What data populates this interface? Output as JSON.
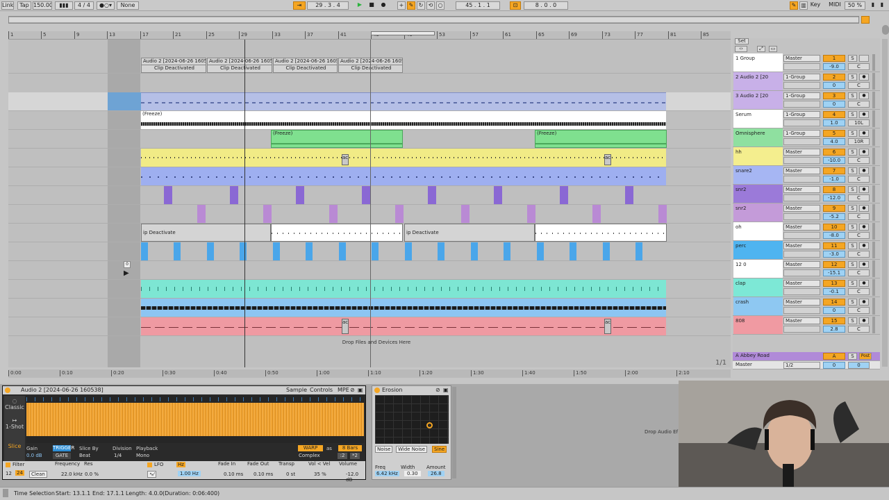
{
  "transport": {
    "link": "Link",
    "tap": "Tap",
    "tempo": "150.00",
    "time_sig": "4 / 4",
    "quantize": "None",
    "position": "29 .  3 .  4",
    "loop_start": "45 .  1 .  1",
    "loop_length": "8 .  0 .  0",
    "key": "Key",
    "midi": "MIDI",
    "cpu": "50 %"
  },
  "ruler": {
    "bars": [
      "1",
      "5",
      "9",
      "13",
      "17",
      "21",
      "25",
      "29",
      "33",
      "37",
      "41",
      "45",
      "49",
      "53",
      "57",
      "61",
      "65",
      "69",
      "73",
      "77",
      "81",
      "85"
    ]
  },
  "timeline": {
    "labels": [
      "0:00",
      "0:10",
      "0:20",
      "0:30",
      "0:40",
      "0:50",
      "1:00",
      "1:10",
      "1:20",
      "1:30",
      "1:40",
      "1:50",
      "2:00",
      "2:10"
    ],
    "page": "1/1"
  },
  "arrangement": {
    "clip_title": "Audio 2 [2024-06-26 1605",
    "clip_deactivated": "Clip Deactivated",
    "freeze": "(Freeze)",
    "short_deact": "ip Deactivate",
    "act": "act",
    "drop_hint": "Drop Files and Devices Here",
    "cursor_value": "0"
  },
  "mixer": {
    "set": "Set",
    "tracks": [
      {
        "name": "1 Group",
        "route": "Master",
        "num": "1",
        "vol": "-9.0",
        "pan": "C",
        "color": "#ffffff",
        "arm": ""
      },
      {
        "name": "2 Audio 2 [20",
        "route": "1-Group",
        "num": "2",
        "vol": "0",
        "pan": "C",
        "color": "#c8b0e8",
        "arm": "●"
      },
      {
        "name": "3 Audio 2 [20",
        "route": "1-Group",
        "num": "3",
        "vol": "0",
        "pan": "C",
        "color": "#c8b0e8",
        "arm": "●"
      },
      {
        "name": "Serum",
        "route": "1-Group",
        "num": "4",
        "vol": "1.0",
        "pan": "10L",
        "color": "#ffffff",
        "arm": "●"
      },
      {
        "name": "Omnisphere",
        "route": "1-Group",
        "num": "5",
        "vol": "4.0",
        "pan": "10R",
        "color": "#8fe0a0",
        "arm": "●"
      },
      {
        "name": "hh",
        "route": "Master",
        "num": "6",
        "vol": "-10.0",
        "pan": "C",
        "color": "#f4ee8e",
        "arm": "●"
      },
      {
        "name": "snare2",
        "route": "Master",
        "num": "7",
        "vol": "-1.0",
        "pan": "C",
        "color": "#a6b6f3",
        "arm": "●"
      },
      {
        "name": "snr2",
        "route": "Master",
        "num": "8",
        "vol": "-12.0",
        "pan": "C",
        "color": "#9b7ad9",
        "arm": "●"
      },
      {
        "name": "snr2",
        "route": "Master",
        "num": "9",
        "vol": "-5.2",
        "pan": "C",
        "color": "#c49bd9",
        "arm": "●"
      },
      {
        "name": "oh",
        "route": "Master",
        "num": "10",
        "vol": "-8.0",
        "pan": "C",
        "color": "#ffffff",
        "arm": "●"
      },
      {
        "name": "perc",
        "route": "Master",
        "num": "11",
        "vol": "-3.0",
        "pan": "C",
        "color": "#4fb4f0",
        "arm": "●"
      },
      {
        "name": "12 0",
        "route": "Master",
        "num": "12",
        "vol": "-15.1",
        "pan": "C",
        "color": "#ffffff",
        "arm": "●"
      },
      {
        "name": "clap",
        "route": "Master",
        "num": "13",
        "vol": "-0.1",
        "pan": "C",
        "color": "#7de8d6",
        "arm": "●"
      },
      {
        "name": "crash",
        "route": "Master",
        "num": "14",
        "vol": "0",
        "pan": "C",
        "color": "#8ec8f2",
        "arm": "●"
      },
      {
        "name": "808",
        "route": "Master",
        "num": "15",
        "vol": "2.8",
        "pan": "C",
        "color": "#f09aa2",
        "arm": "●"
      }
    ],
    "return": {
      "name": "A Abbey Road",
      "num": "A",
      "post": "Post"
    },
    "master": {
      "name": "Master",
      "route": "1/2",
      "vol": "0",
      "pan": "0"
    }
  },
  "sampler": {
    "title": "Audio 2 [2024-06-26 160538]",
    "tabs": [
      "Sample",
      "Controls",
      "MPE"
    ],
    "modes": [
      "Classic",
      "1-Shot",
      "Slice"
    ],
    "gain_label": "Gain",
    "gain": "0.0 dB",
    "trigger": "TRIGGER",
    "gate": "GATE",
    "slice_by_label": "Slice By",
    "slice_by": "Beat",
    "division_label": "Division",
    "division": "1/4",
    "playback_label": "Playback",
    "playback": "Mono",
    "warp": "WARP",
    "as": "as",
    "bars": "8 Bars",
    "complex": "Complex",
    "half": ":2",
    "double": "*2",
    "filter_label": "Filter",
    "filter_a": "12",
    "filter_b": "24",
    "filter_type": "Clean",
    "freq_label": "Frequency",
    "freq": "22.0 kHz",
    "res_label": "Res",
    "res": "0.0 %",
    "lfo_label": "LFO",
    "lfo_hz": "Hz",
    "lfo_rate": "1.00 Hz",
    "fadein_label": "Fade In",
    "fadein": "0.10 ms",
    "fadeout_label": "Fade Out",
    "fadeout": "0.10 ms",
    "transp_label": "Transp",
    "transp": "0 st",
    "velvol_label": "Vol < Vel",
    "velvol": "35 %",
    "volume_label": "Volume",
    "volume": "-12.0 dB"
  },
  "erosion": {
    "title": "Erosion",
    "modes": [
      "Noise",
      "Wide Noise",
      "Sine"
    ],
    "freq_label": "Freq",
    "freq": "6.42 kHz",
    "width_label": "Width",
    "width": "0.30",
    "amount_label": "Amount",
    "amount": "26.8"
  },
  "drop_audio": "Drop Audio Ef",
  "status": {
    "mode": "Time Selection",
    "start": "Start: 13.1.1",
    "end": "End: 17.1.1",
    "length": "Length: 4.0.0",
    "duration": "(Duration: 0:06:400)"
  }
}
